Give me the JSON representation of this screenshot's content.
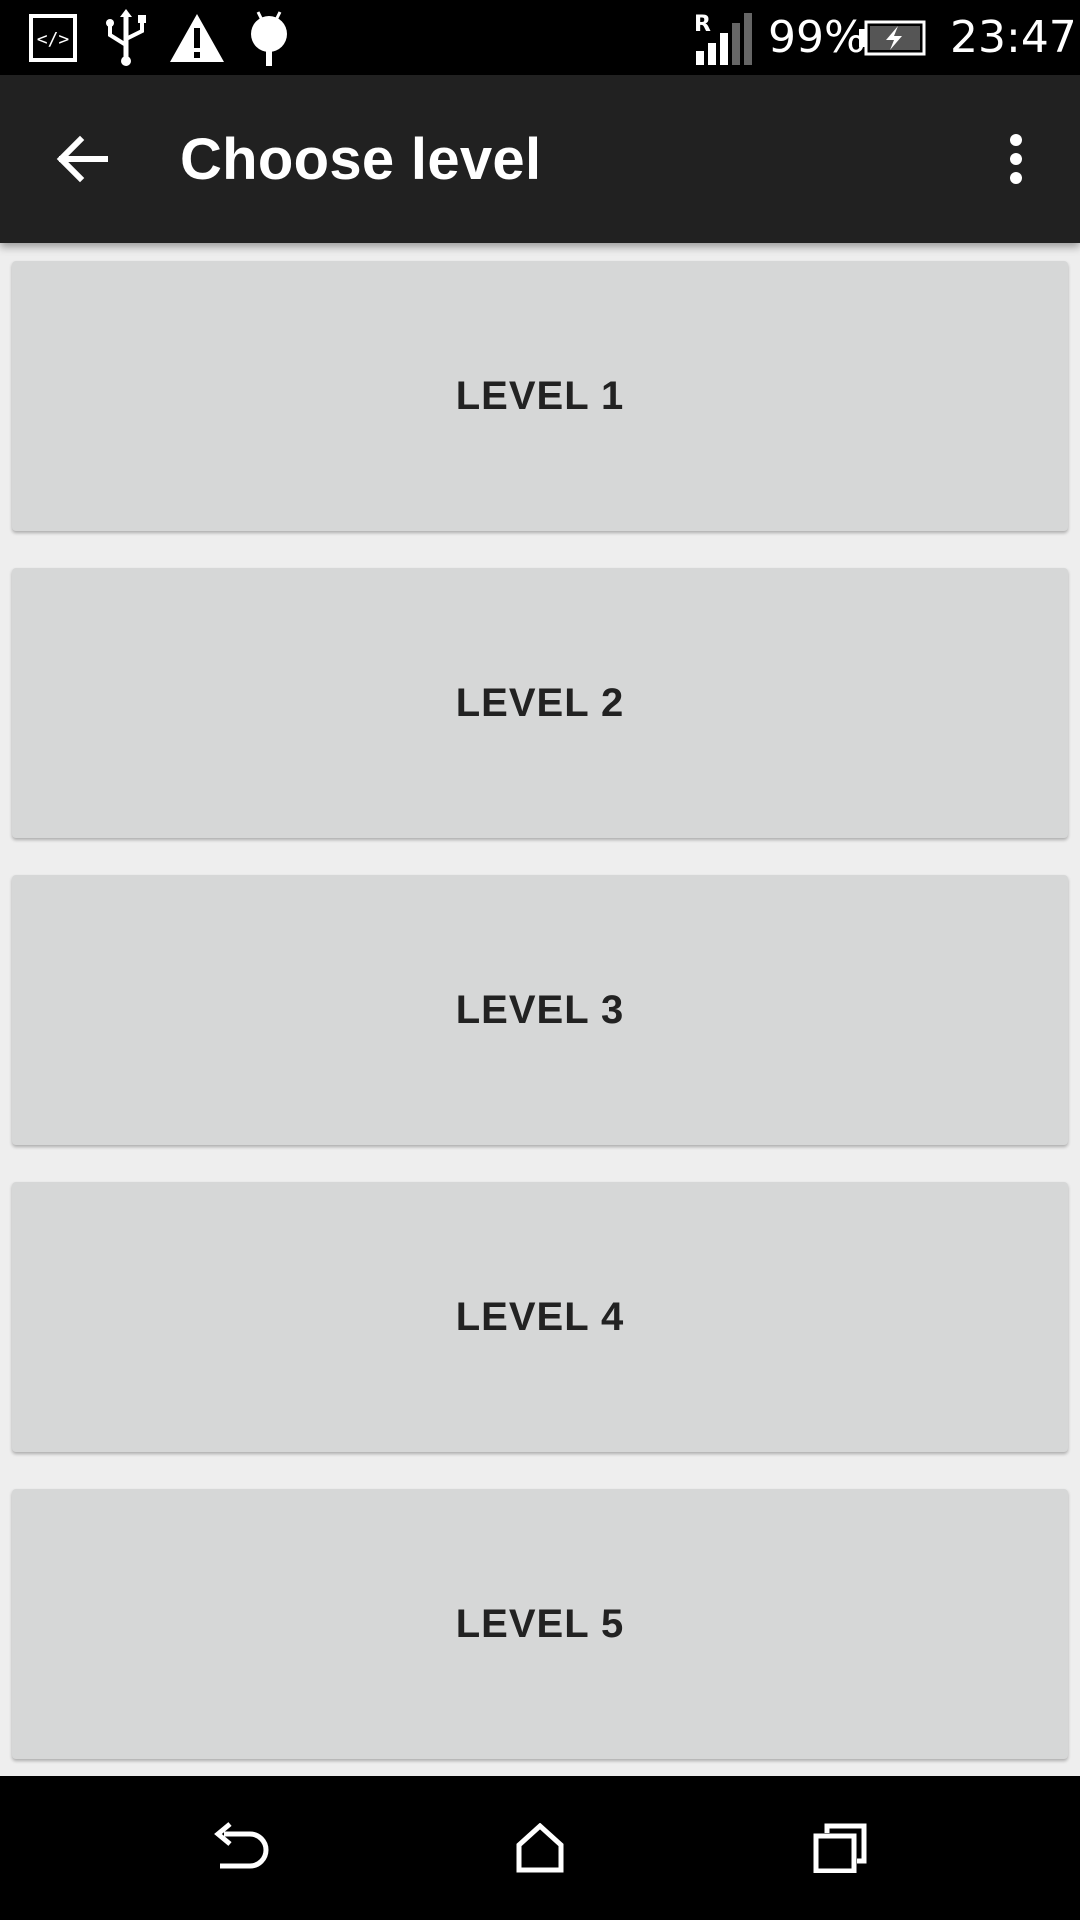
{
  "status_bar": {
    "signal_letter": "R",
    "battery_percent": "99%",
    "time": "23:47",
    "icons": [
      "developer-code-icon",
      "usb-icon",
      "warning-icon",
      "android-debug-icon",
      "signal-icon",
      "battery-charging-icon"
    ]
  },
  "toolbar": {
    "title": "Choose level",
    "back_icon": "arrow-back-icon",
    "overflow_icon": "more-vertical-icon"
  },
  "levels": [
    {
      "label": "LEVEL 1"
    },
    {
      "label": "LEVEL 2"
    },
    {
      "label": "LEVEL 3"
    },
    {
      "label": "LEVEL 4"
    },
    {
      "label": "LEVEL 5"
    }
  ],
  "nav_bar": {
    "icons": [
      "back-nav-icon",
      "home-nav-icon",
      "recents-nav-icon"
    ]
  },
  "colors": {
    "status_bar": "#000000",
    "toolbar": "#212121",
    "background": "#eeeeee",
    "button": "#d6d7d7",
    "button_text": "#222222"
  }
}
